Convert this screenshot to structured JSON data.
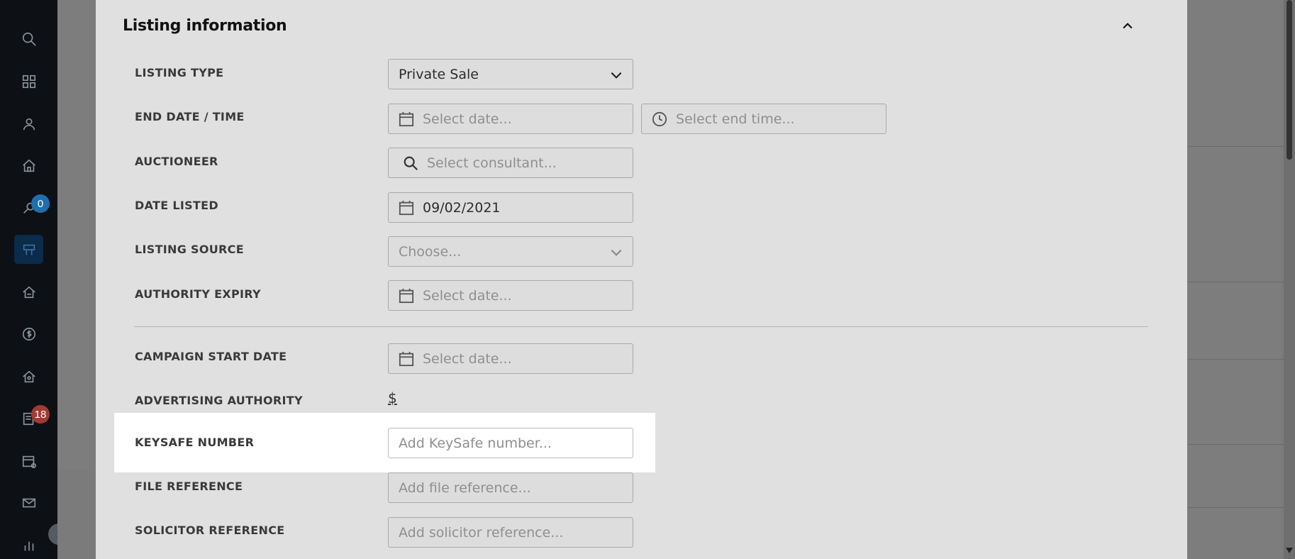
{
  "sidebar": {
    "items": [
      {
        "name": "search-icon"
      },
      {
        "name": "dashboard-icon"
      },
      {
        "name": "contacts-icon"
      },
      {
        "name": "properties-icon"
      },
      {
        "name": "prospects-icon",
        "badge": "0",
        "badge_color": "#1e6fae"
      },
      {
        "name": "listings-icon",
        "active": true
      },
      {
        "name": "homes-icon"
      },
      {
        "name": "finance-icon"
      },
      {
        "name": "rentals-icon"
      },
      {
        "name": "tasks-icon",
        "badge": "18",
        "badge_color": "#c0392b"
      },
      {
        "name": "calendar-icon"
      },
      {
        "name": "mail-icon"
      },
      {
        "name": "reports-icon"
      }
    ]
  },
  "modal": {
    "title": "Listing information",
    "fields": {
      "listing_type": {
        "label": "LISTING TYPE",
        "value": "Private Sale"
      },
      "end_date_time": {
        "label": "END DATE / TIME",
        "date_placeholder": "Select date...",
        "time_placeholder": "Select end time..."
      },
      "auctioneer": {
        "label": "AUCTIONEER",
        "placeholder": "Select consultant..."
      },
      "date_listed": {
        "label": "DATE LISTED",
        "value": "09/02/2021"
      },
      "listing_source": {
        "label": "LISTING SOURCE",
        "placeholder": "Choose..."
      },
      "authority_expiry": {
        "label": "AUTHORITY EXPIRY",
        "placeholder": "Select date..."
      },
      "campaign_start_date": {
        "label": "CAMPAIGN START DATE",
        "placeholder": "Select date..."
      },
      "advertising_authority": {
        "label": "ADVERTISING AUTHORITY",
        "value": "$"
      },
      "keysafe_number": {
        "label": "KEYSAFE NUMBER",
        "placeholder": "Add KeySafe number..."
      },
      "file_reference": {
        "label": "FILE REFERENCE",
        "placeholder": "Add file reference..."
      },
      "solicitor_reference": {
        "label": "SOLICITOR REFERENCE",
        "placeholder": "Add solicitor reference..."
      }
    }
  }
}
